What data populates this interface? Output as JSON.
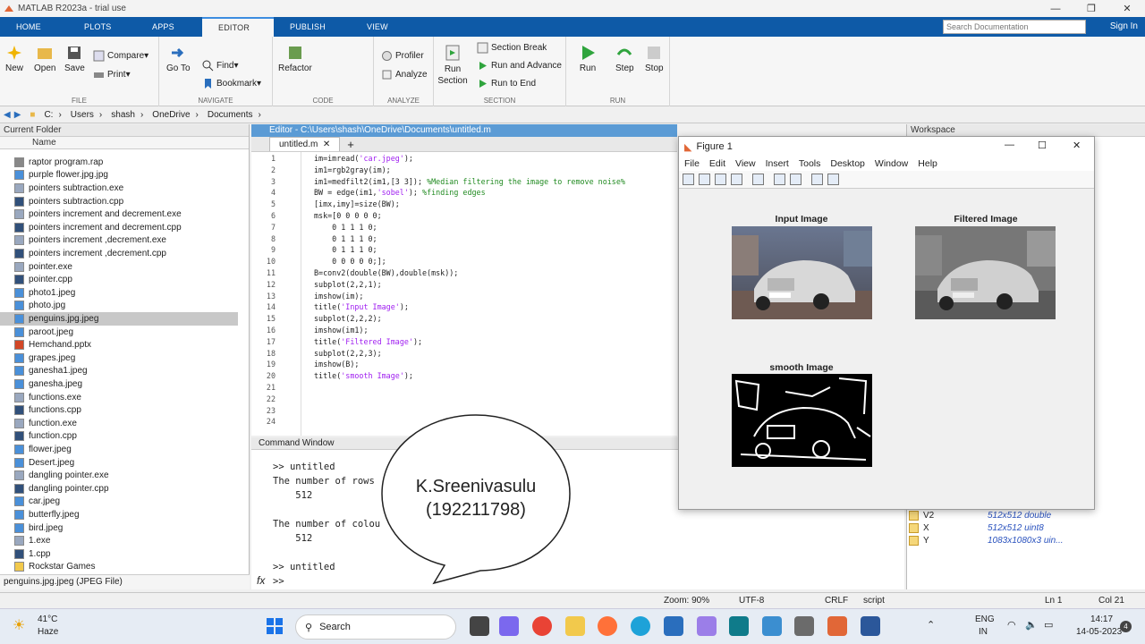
{
  "window": {
    "title": "MATLAB R2023a - trial use"
  },
  "ribbon_tabs": [
    "HOME",
    "PLOTS",
    "APPS",
    "EDITOR",
    "PUBLISH",
    "VIEW"
  ],
  "search_doc_placeholder": "Search Documentation",
  "sign_in": "Sign In",
  "ribbon": {
    "file": {
      "label": "FILE",
      "new": "New",
      "open": "Open",
      "save": "Save",
      "compare": "Compare",
      "print": "Print"
    },
    "navigate": {
      "label": "NAVIGATE",
      "goto": "Go To",
      "find": "Find",
      "bookmark": "Bookmark"
    },
    "code": {
      "label": "CODE",
      "refactor": "Refactor"
    },
    "analyze": {
      "label": "ANALYZE",
      "profiler": "Profiler",
      "analyze": "Analyze"
    },
    "section": {
      "label": "SECTION",
      "run_section": "Run Section",
      "section_break": "Section Break",
      "run_advance": "Run and Advance",
      "run_end": "Run to End"
    },
    "run": {
      "label": "RUN",
      "run": "Run",
      "step": "Step",
      "stop": "Stop"
    }
  },
  "address": [
    "C:",
    "Users",
    "shash",
    "OneDrive",
    "Documents"
  ],
  "current_folder": {
    "title": "Current Folder",
    "col_name": "Name",
    "files": [
      "raptor program.rap",
      "purple flower.jpg.jpg",
      "pointers subtraction.exe",
      "pointers subtraction.cpp",
      "pointers increment and decrement.exe",
      "pointers increment and decrement.cpp",
      "pointers increment ,decrement.exe",
      "pointers increment ,decrement.cpp",
      "pointer.exe",
      "pointer.cpp",
      "photo1.jpeg",
      "photo.jpg",
      "penguins.jpg.jpeg",
      "paroot.jpeg",
      "Hemchand.pptx",
      "grapes.jpeg",
      "ganesha1.jpeg",
      "ganesha.jpeg",
      "functions.exe",
      "functions.cpp",
      "function.exe",
      "function.cpp",
      "flower.jpeg",
      "Desert.jpeg",
      "dangling pointer.exe",
      "dangling pointer.cpp",
      "car.jpeg",
      "butterfly.jpeg",
      "bird.jpeg",
      "1.exe",
      "1.cpp",
      "Rockstar Games"
    ],
    "selected": "penguins.jpg.jpeg",
    "detail": "penguins.jpg.jpeg  (JPEG File)"
  },
  "editor": {
    "header": "Editor - C:\\Users\\shash\\OneDrive\\Documents\\untitled.m",
    "tab": "untitled.m"
  },
  "code_lines": [
    [
      "im=imread(",
      "'car.jpeg'",
      ");",
      ""
    ],
    [
      "im1=rgb2gray(im);",
      "",
      "",
      ""
    ],
    [
      "im1=medfilt2(im1,[3 3]); ",
      "",
      "",
      "%Median filtering the image to remove noise%"
    ],
    [
      "BW = edge(im1,",
      "'sobel'",
      "); ",
      "%finding edges"
    ],
    [
      "[imx,imy]=size(BW);",
      "",
      "",
      ""
    ],
    [
      "msk=[0 0 0 0 0;",
      "",
      "",
      ""
    ],
    [
      "    0 1 1 1 0;",
      "",
      "",
      ""
    ],
    [
      "    0 1 1 1 0;",
      "",
      "",
      ""
    ],
    [
      "    0 1 1 1 0;",
      "",
      "",
      ""
    ],
    [
      "    0 0 0 0 0;];",
      "",
      "",
      ""
    ],
    [
      "B=conv2(double(BW),double(msk));",
      "",
      "",
      ""
    ],
    [
      "subplot(2,2,1);",
      "",
      "",
      ""
    ],
    [
      "imshow(im);",
      "",
      "",
      ""
    ],
    [
      "title(",
      "'Input Image'",
      ");",
      ""
    ],
    [
      "subplot(2,2,2);",
      "",
      "",
      ""
    ],
    [
      "imshow(im1);",
      "",
      "",
      ""
    ],
    [
      "title(",
      "'Filtered Image'",
      ");",
      ""
    ],
    [
      "subplot(2,2,3);",
      "",
      "",
      ""
    ],
    [
      "imshow(B);",
      "",
      "",
      ""
    ],
    [
      "title(",
      "'smooth Image'",
      ");",
      ""
    ],
    [
      "",
      "",
      "",
      ""
    ],
    [
      "",
      "",
      "",
      ""
    ],
    [
      "",
      "",
      "",
      ""
    ],
    [
      "",
      "",
      "",
      ""
    ]
  ],
  "command_window": {
    "title": "Command Window",
    "lines": [
      ">> untitled",
      "The number of rows",
      "    512",
      "",
      "The number of colou",
      "    512",
      "",
      ">> untitled"
    ],
    "prompt": ">>",
    "fx": "fx"
  },
  "workspace": {
    "title": "Workspace",
    "vars": [
      {
        "name": "V2",
        "value": "512x512 double"
      },
      {
        "name": "X",
        "value": "512x512 uint8"
      },
      {
        "name": "Y",
        "value": "1083x1080x3 uin..."
      }
    ]
  },
  "figure": {
    "title": "Figure 1",
    "menu": [
      "File",
      "Edit",
      "View",
      "Insert",
      "Tools",
      "Desktop",
      "Window",
      "Help"
    ],
    "subplots": [
      "Input Image",
      "Filtered Image",
      "smooth Image"
    ]
  },
  "bubble": {
    "name": "K.Sreenivasulu",
    "id": "(192211798)"
  },
  "status": {
    "zoom": "Zoom: 90%",
    "enc": "UTF-8",
    "eol": "CRLF",
    "mode": "script",
    "ln": "Ln  1",
    "col": "Col  21"
  },
  "taskbar": {
    "weather_temp": "41°C",
    "weather_desc": "Haze",
    "search": "Search",
    "lang1": "ENG",
    "lang2": "IN",
    "time": "14:17",
    "date": "14-05-2023",
    "badge": "4"
  }
}
